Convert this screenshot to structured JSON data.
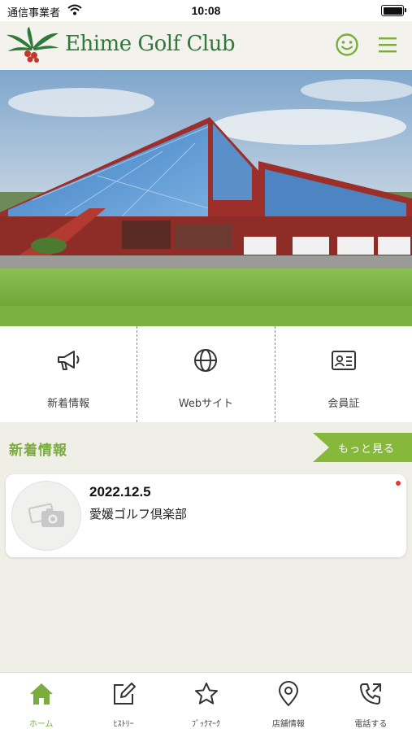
{
  "status_bar": {
    "carrier": "通信事業者",
    "time": "10:08"
  },
  "header": {
    "title": "Ehime Golf Club",
    "smile_icon": "smile-icon",
    "menu_icon": "hamburger-menu-icon"
  },
  "colors": {
    "brand_green": "#2f7a3a",
    "accent_green": "#86b83c",
    "background": "#efeee7"
  },
  "quick_menu": {
    "items": [
      {
        "label": "新着情報",
        "icon": "megaphone-icon"
      },
      {
        "label": "Webサイト",
        "icon": "globe-icon"
      },
      {
        "label": "会員証",
        "icon": "member-card-icon"
      }
    ]
  },
  "news": {
    "section_title": "新着情報",
    "more_label": "もっと見る",
    "items": [
      {
        "date": "2022.12.5",
        "title": "愛媛ゴルフ倶楽部"
      }
    ]
  },
  "tab_bar": {
    "tabs": [
      {
        "label": "ホーム",
        "icon": "home-icon"
      },
      {
        "label": "ﾋｽﾄﾘｰ",
        "icon": "edit-icon"
      },
      {
        "label": "ﾌﾞｯｸﾏｰｸ",
        "icon": "star-icon"
      },
      {
        "label": "店舗情報",
        "icon": "location-pin-icon"
      },
      {
        "label": "電話する",
        "icon": "phone-icon"
      }
    ]
  }
}
